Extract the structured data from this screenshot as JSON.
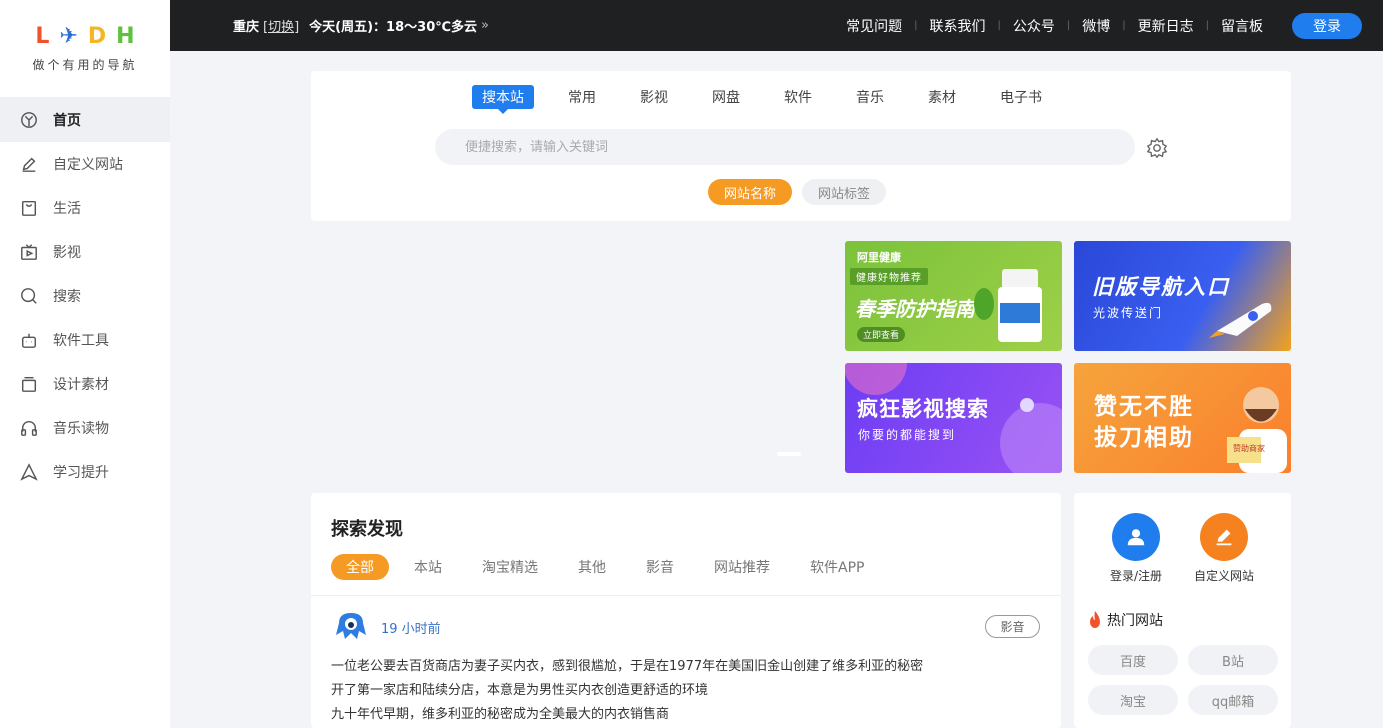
{
  "brand": {
    "letters": [
      "L",
      "✈",
      "D",
      "H"
    ],
    "letter_colors": [
      "#f0532b",
      "#2a6fd8",
      "#f5b623",
      "#5bc23b"
    ],
    "tagline": "做个有用的导航"
  },
  "sidebar": {
    "items": [
      {
        "label": "首页",
        "icon": "home-icon",
        "active": true
      },
      {
        "label": "自定义网站",
        "icon": "pencil-icon"
      },
      {
        "label": "生活",
        "icon": "bag-icon"
      },
      {
        "label": "影视",
        "icon": "tv-icon"
      },
      {
        "label": "搜索",
        "icon": "search-icon"
      },
      {
        "label": "软件工具",
        "icon": "robot-icon"
      },
      {
        "label": "设计素材",
        "icon": "layers-icon"
      },
      {
        "label": "音乐读物",
        "icon": "headphones-icon"
      },
      {
        "label": "学习提升",
        "icon": "triangle-icon"
      }
    ]
  },
  "topbar": {
    "city": "重庆",
    "switch_label": "[切换]",
    "weather": "今天(周五)：18～30℃多云",
    "links": [
      "常见问题",
      "联系我们",
      "公众号",
      "微博",
      "更新日志",
      "留言板"
    ],
    "login_label": "登录"
  },
  "search": {
    "tabs": [
      "搜本站",
      "常用",
      "影视",
      "网盘",
      "软件",
      "音乐",
      "素材",
      "电子书"
    ],
    "active_tab": "搜本站",
    "placeholder": "便捷搜索，请输入关键词",
    "modes": [
      "网站名称",
      "网站标签"
    ],
    "active_mode": "网站名称"
  },
  "banners": [
    {
      "brand": "阿里健康",
      "badge": "健康好物推荐",
      "title": "春季防护指南",
      "cta": "立即查看"
    },
    {
      "title": "旧版导航入口",
      "subtitle": "光波传送门"
    },
    {
      "title": "疯狂影视搜索",
      "subtitle": "你要的都能搜到"
    },
    {
      "title_line1": "赞无不胜",
      "title_line2": "拔刀相助",
      "stamp": "赞助商家"
    }
  ],
  "discover": {
    "title": "探索发现",
    "tabs": [
      "全部",
      "本站",
      "淘宝精选",
      "其他",
      "影音",
      "网站推荐",
      "软件APP"
    ],
    "active_tab": "全部",
    "post": {
      "time": "19 小时前",
      "tag": "影音",
      "lines": [
        "一位老公要去百货商店为妻子买内衣，感到很尴尬，于是在1977年在美国旧金山创建了维多利亚的秘密",
        "开了第一家店和陆续分店，本意是为男性买内衣创造更舒适的环境",
        "九十年代早期，维多利亚的秘密成为全美最大的内衣销售商"
      ]
    }
  },
  "side": {
    "actions": [
      {
        "label": "登录/注册",
        "icon": "user-icon",
        "color": "#1f7ded"
      },
      {
        "label": "自定义网站",
        "icon": "edit-icon",
        "color": "#f5821f"
      }
    ],
    "hot_title": "热门网站",
    "hot_sites": [
      "百度",
      "B站",
      "淘宝",
      "qq邮箱"
    ]
  }
}
